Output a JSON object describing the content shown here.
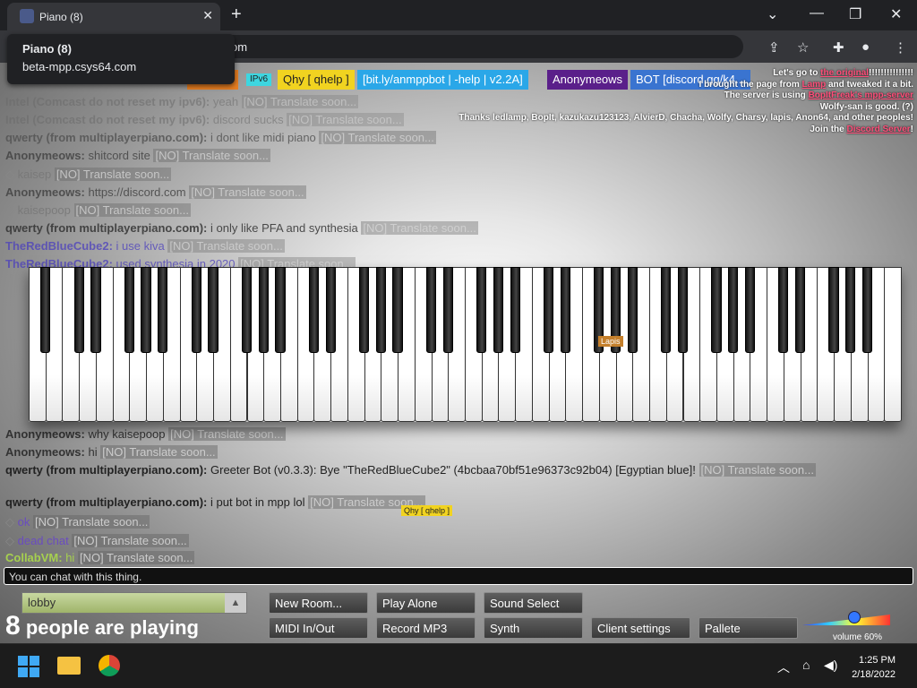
{
  "browser": {
    "tab_title": "Piano (8)",
    "tooltip_title": "Piano (8)",
    "tooltip_url": "beta-mpp.csys64.com",
    "address_suffix": "om"
  },
  "userbar": [
    {
      "name": "siceon7",
      "color": "#e67e22"
    },
    {
      "name": "IPv6",
      "color": "#3dd6e0"
    },
    {
      "name": "Qhy [ qhelp ]",
      "color": "#f1d320"
    },
    {
      "name": "[bit.ly/anmppbot | -help | v2.2A]",
      "color": "#2aa7e8"
    },
    {
      "name": "Anonymeows",
      "color": "#5a1f8a"
    },
    {
      "name": "BOT  [discord.gg/k4...",
      "color": "#3a74d0"
    }
  ],
  "notice": {
    "line1a": "Let's go to",
    "line1b": "the original",
    "line1c": "!!!!!!!!!!!!!!!",
    "line2a": "I brought the page from",
    "line2b": "Lamp",
    "line2c": "and tweaked it a bit.",
    "line3a": "The server is using",
    "line3b": "BopItFreak's mpp-server",
    "line4": "Wolfy-san is good. (?)",
    "line5": "Thanks ledlamp, BopIt, kazukazu123123, AlvierD, Chacha, Wolfy, Charsy, lapis, Anon64, and other peoples!",
    "line6a": "Join the",
    "line6b": "Discord Server",
    "line6c": "!"
  },
  "chat": [
    {
      "name": "Intel (Comcast do not reset my ipv6):",
      "text": "yeah",
      "tr": "[NO] Translate soon...",
      "color": "#6a6a6a"
    },
    {
      "name": "Intel (Comcast do not reset my ipv6):",
      "text": "discord sucks",
      "tr": "[NO] Translate soon...",
      "color": "#6a6a6a"
    },
    {
      "name": "qwerty (from multiplayerpiano.com):",
      "text": "i dont like midi piano",
      "tr": "[NO] Translate soon...",
      "color": "#555"
    },
    {
      "name": "Anonymeows:",
      "text": "shitcord site",
      "tr": "[NO] Translate soon...",
      "color": "#444"
    },
    {
      "name": "",
      "text": "kaisep",
      "tr": "[NO] Translate soon...",
      "color": "#777"
    },
    {
      "name": "Anonymeows:",
      "text": "https://discord.com",
      "tr": "[NO] Translate soon...",
      "color": "#444"
    },
    {
      "name": "",
      "text": "kaisepoop",
      "tr": "[NO] Translate soon...",
      "color": "#777"
    },
    {
      "name": "qwerty (from multiplayerpiano.com):",
      "text": "i only like PFA and synthesia",
      "tr": "[NO] Translate soon...",
      "color": "#333"
    },
    {
      "name": "TheRedBlueCube2:",
      "text": "i use kiva",
      "tr": "[NO] Translate soon...",
      "color": "#4b3fbd"
    },
    {
      "name": "TheRedBlueCube2:",
      "text": "used synthesia in 2020",
      "tr": "[NO] Translate soon...",
      "color": "#4b3fbd"
    }
  ],
  "chat_lower": [
    {
      "name": "Anonymeows:",
      "text": "why kaisepoop",
      "tr": "[NO] Translate soon...",
      "color": "#333"
    },
    {
      "name": "Anonymeows:",
      "text": "hi",
      "tr": "[NO] Translate soon...",
      "color": "#333"
    },
    {
      "name": "qwerty (from multiplayerpiano.com):",
      "text": "Greeter Bot (v0.3.3): Bye \"TheRedBlueCube2\" (4bcbaa70bf51e96373c92b04) [Egyptian blue]!",
      "tr": "[NO] Translate soon...",
      "color": "#222"
    },
    {
      "name": "qwerty (from multiplayerpiano.com):",
      "text": "i put bot in mpp lol",
      "tr": "[NO] Translate soon...",
      "color": "#222"
    },
    {
      "name": "",
      "text": "ok",
      "tr": "[NO] Translate soon...",
      "color": "#6a4cc0"
    },
    {
      "name": "",
      "text": "dead chat",
      "tr": "[NO] Translate soon...",
      "color": "#6a4cc0"
    },
    {
      "name": "CollabVM:",
      "text": "hi",
      "tr": "[NO] Translate soon...",
      "color": "#a6d04f"
    }
  ],
  "cursors": [
    {
      "label": "Lapis",
      "color": "#c47f2b"
    },
    {
      "label": "Qhy [ qhelp ]",
      "color": "#f1d320"
    }
  ],
  "chat_input_placeholder": "You can chat with this thing.",
  "room": "lobby",
  "buttons": {
    "new_room": "New Room...",
    "play_alone": "Play Alone",
    "sound_select": "Sound Select",
    "midi": "MIDI In/Out",
    "record": "Record MP3",
    "synth": "Synth",
    "client_settings": "Client settings",
    "pallete": "Pallete"
  },
  "playing_count": "8",
  "playing_text": "people are playing",
  "volume_label": "volume 60%",
  "volume_level": 0.6,
  "clock": {
    "time": "1:25 PM",
    "date": "2/18/2022"
  }
}
